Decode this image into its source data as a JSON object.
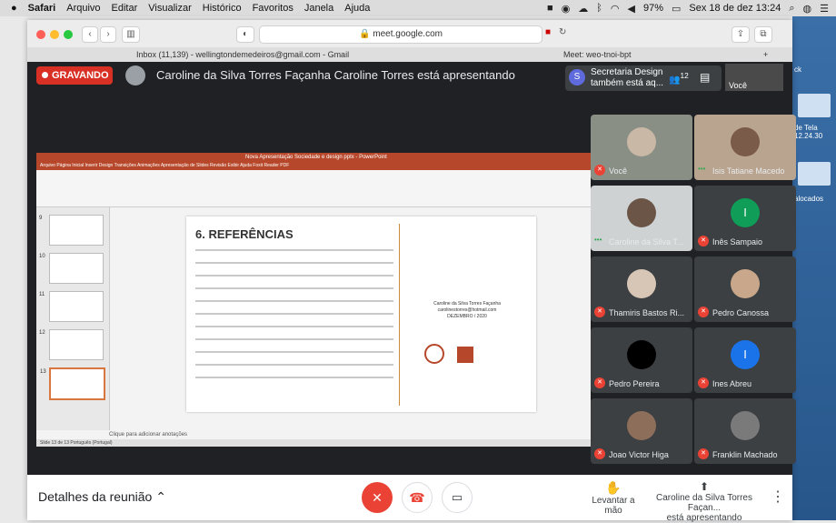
{
  "menubar": {
    "apple": "",
    "items": [
      "Safari",
      "Arquivo",
      "Editar",
      "Visualizar",
      "Histórico",
      "Favoritos",
      "Janela",
      "Ajuda"
    ],
    "battery": "97%",
    "clock": "Sex 18 de dez 13:24"
  },
  "safari": {
    "url": "meet.google.com",
    "tabs": [
      "Inbox (11,139) - wellingtondemedeiros@gmail.com - Gmail",
      "Meet: weo-tnoi-bpt"
    ]
  },
  "desktop": {
    "label_top": "ck",
    "label_mid": "de Tela",
    "label_mid2": "12.24.30",
    "label_bottom": "alocados"
  },
  "meet": {
    "recording": "GRAVANDO",
    "presenting_text": "Caroline da Silva Torres Façanha Caroline Torres está apresentando",
    "notification": {
      "avatar": "S",
      "text": "Secretaria Design também está aq...",
      "participants": "12"
    },
    "self_top_label": "Você",
    "tiles": [
      {
        "name": "Você",
        "muted": true
      },
      {
        "name": "Isis Tatiane Macedo",
        "muted": false
      },
      {
        "name": "Caroline da Silva T...",
        "muted": false
      },
      {
        "name": "Inês Sampaio",
        "muted": true,
        "initial": "I"
      },
      {
        "name": "Thamiris Bastos Ri...",
        "muted": true
      },
      {
        "name": "Pedro Canossa",
        "muted": true
      },
      {
        "name": "Pedro Pereira",
        "muted": true
      },
      {
        "name": "Ines Abreu",
        "muted": true,
        "initial": "I"
      },
      {
        "name": "Joao Victor Higa",
        "muted": true
      },
      {
        "name": "Franklin Machado",
        "muted": true
      }
    ],
    "bottom": {
      "details": "Detalhes da reunião",
      "raise_hand": "Levantar a mão",
      "presenter": "Caroline da Silva Torres Façan...",
      "presenting_short": "está apresentando"
    }
  },
  "ppt": {
    "title": "Nova Apresentação Sociedade e design pptx  -  PowerPoint",
    "menu": "Arquivo   Página Inicial   Inserir   Design   Transições   Animações   Apresentação de Slides   Revisão   Exibir   Ajuda   Foxit Reader PDF",
    "slide_numbers": [
      "9",
      "10",
      "11",
      "12",
      "13"
    ],
    "slide_title": "6. REFERÊNCIAS",
    "author": "Caroline da Silva Torres Façanha",
    "email": "carolinestorres@hotmail.com",
    "date": "DEZEMBRO / 2020",
    "notes": "Clique para adicionar anotações",
    "status": "Slide 13 de 13     Português (Portugal)"
  }
}
